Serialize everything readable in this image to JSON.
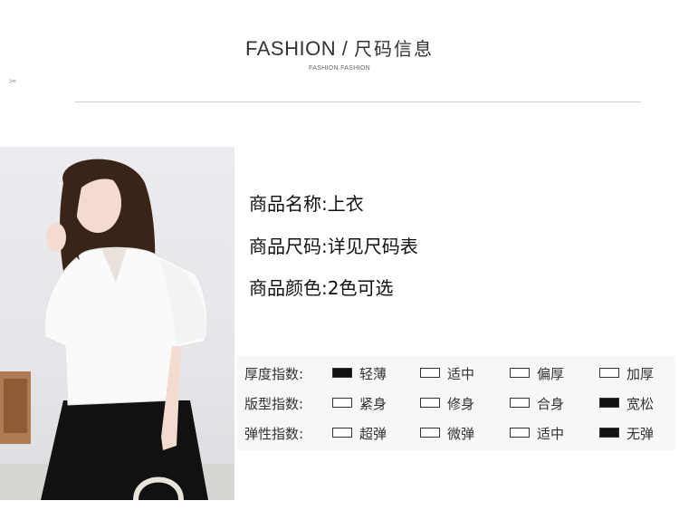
{
  "header": {
    "title_en": "FASHION",
    "separator": "/",
    "title_cn": "尺码信息",
    "subtitle": "FASHION FASHION"
  },
  "product_info": [
    "商品名称:上衣",
    "商品尺码:详见尺码表",
    "商品颜色:2色可选"
  ],
  "indices": [
    {
      "label": "厚度指数:",
      "options": [
        "轻薄",
        "适中",
        "偏厚",
        "加厚"
      ],
      "selected": 0
    },
    {
      "label": "版型指数:",
      "options": [
        "紧身",
        "修身",
        "合身",
        "宽松"
      ],
      "selected": 3
    },
    {
      "label": "弹性指数:",
      "options": [
        "超弹",
        "微弹",
        "适中",
        "无弹"
      ],
      "selected": 3
    }
  ],
  "colors": {
    "blouse": "#fafafa",
    "skirt": "#111111",
    "background": "#e9e9ed",
    "hair": "#3a2418"
  }
}
